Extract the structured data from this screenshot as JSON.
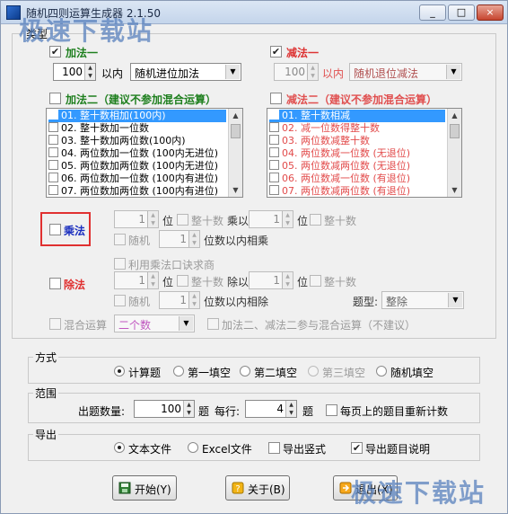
{
  "window": {
    "title": "随机四则运算生成器 2.1.50",
    "controls": [
      "_",
      "□",
      "×"
    ]
  },
  "watermark": "极速下载站",
  "types_group": {
    "legend": "类型"
  },
  "add1": {
    "label": "加法一",
    "checked": "✔",
    "range_value": "100",
    "range_unit": "以内",
    "mode": "随机进位加法"
  },
  "sub1": {
    "label": "减法一",
    "checked": "✔",
    "range_value": "100",
    "range_unit": "以内",
    "mode": "随机退位减法"
  },
  "add2": {
    "label": "加法二（建议不参加混合运算）",
    "items": [
      "01. 整十数相加(100内)",
      "02. 整十数加一位数",
      "03. 整十数加两位数(100内)",
      "04. 两位数加一位数 (100内无进位)",
      "05. 两位数加两位数 (100内无进位)",
      "06. 两位数加一位数 (100内有进位)",
      "07. 两位数加两位数 (100内有进位)"
    ]
  },
  "sub2": {
    "label": "减法二（建议不参加混合运算）",
    "items": [
      "01. 整十数相减",
      "02. 减一位数得整十数",
      "03. 两位数减整十数",
      "04. 两位数减一位数 (无退位)",
      "05. 两位数减两位数 (无退位)",
      "06. 两位数减一位数 (有退位)",
      "07. 两位数减两位数 (有退位)"
    ]
  },
  "mul": {
    "label": "乘法",
    "left_value": "1",
    "unit_digit": "位",
    "whole_ten": "整十数",
    "times": "乘以",
    "right_value": "1",
    "random": "随机",
    "random_value": "1",
    "random_suffix": "位数以内相乘"
  },
  "div": {
    "label": "除法",
    "use_mul": "利用乘法口诀求商",
    "left_value": "1",
    "unit_digit": "位",
    "whole_ten": "整十数",
    "divide": "除以",
    "right_value": "1",
    "random": "随机",
    "random_value": "1",
    "random_suffix": "位数以内相除",
    "type_label": "题型:",
    "type_value": "整除"
  },
  "mixed": {
    "label": "混合运算",
    "count": "二个数",
    "note": "加法二、减法二参与混合运算（不建议）"
  },
  "method": {
    "legend": "方式",
    "options": [
      "计算题",
      "第一填空",
      "第二填空",
      "第三填空",
      "随机填空"
    ]
  },
  "range": {
    "legend": "范围",
    "count_label": "出题数量:",
    "count_value": "100",
    "count_unit": "题",
    "per_row_label": "每行:",
    "per_row_value": "4",
    "per_row_unit": "题",
    "recount": "每页上的题目重新计数"
  },
  "export": {
    "legend": "导出",
    "text_file": "文本文件",
    "excel_file": "Excel文件",
    "vertical": "导出竖式",
    "with_desc": "导出题目说明"
  },
  "buttons": {
    "start": "开始(Y)",
    "about": "关于(B)",
    "exit": "退出(X)"
  }
}
